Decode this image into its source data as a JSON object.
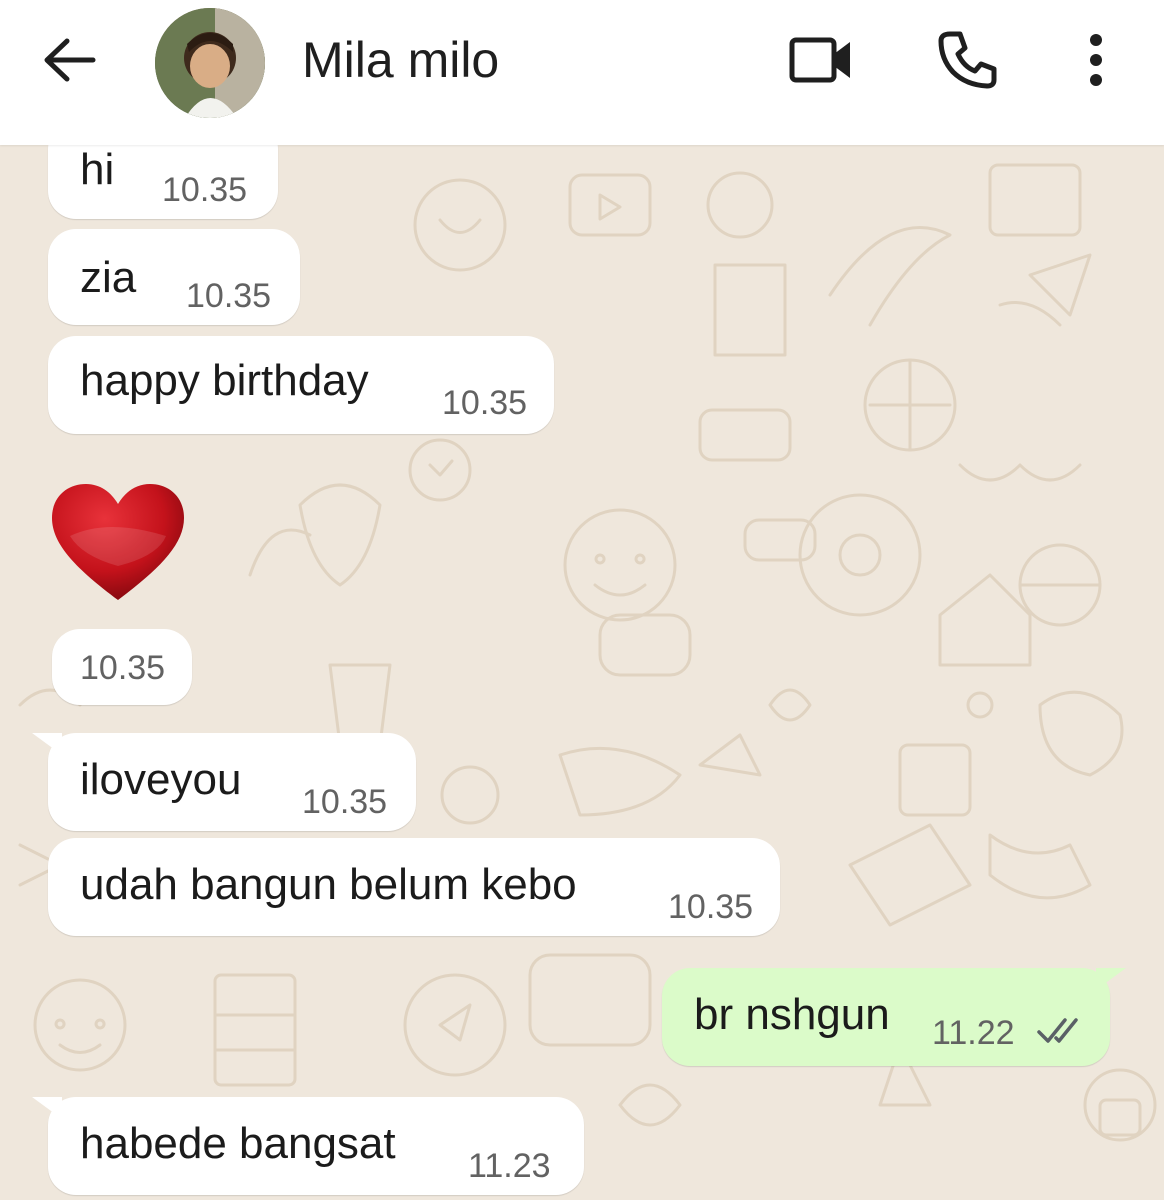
{
  "header": {
    "contact_name": "Mila milo",
    "icons": [
      "back-arrow-icon",
      "avatar",
      "video-call-icon",
      "phone-icon",
      "more-vertical-icon"
    ]
  },
  "colors": {
    "header_bg": "#ffffff",
    "chat_bg": "#efe7dc",
    "incoming_bubble": "#ffffff",
    "outgoing_bubble": "#dbfbc9",
    "heart": "#c4121b"
  },
  "messages": [
    {
      "direction": "in",
      "text": "hi",
      "time": "10.35"
    },
    {
      "direction": "in",
      "text": "zia",
      "time": "10.35"
    },
    {
      "direction": "in",
      "text": "happy birthday",
      "time": "10.35"
    },
    {
      "direction": "in",
      "emoji": "heart",
      "time": "10.35"
    },
    {
      "direction": "in",
      "text": "iloveyou",
      "time": "10.35"
    },
    {
      "direction": "in",
      "text": "udah bangun belum kebo",
      "time": "10.35"
    },
    {
      "direction": "out",
      "text": "br nshgun",
      "time": "11.22",
      "status": "read-double-check"
    },
    {
      "direction": "in",
      "text": "habede bangsat",
      "time": "11.23"
    }
  ]
}
